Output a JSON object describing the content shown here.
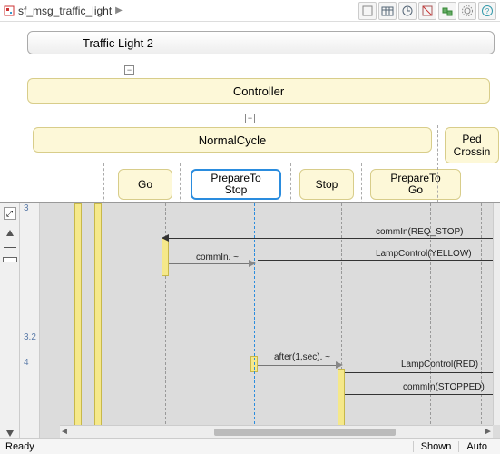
{
  "breadcrumb": {
    "file": "sf_msg_traffic_light"
  },
  "toolbar_icons": [
    "icon-a",
    "icon-b",
    "icon-c",
    "icon-d",
    "icon-e",
    "icon-f",
    "icon-g"
  ],
  "states": {
    "traffic_light_2": "Traffic Light 2",
    "controller": "Controller",
    "normal_cycle": "NormalCycle",
    "ped_crossing": "Ped Crossin",
    "go": "Go",
    "prepare_to_stop": "PrepareTo Stop",
    "stop": "Stop",
    "prepare_to_go": "PrepareTo Go"
  },
  "collapse_glyph": "⊟",
  "timeline": {
    "t1": "3",
    "t2": "3.2",
    "t3": "4"
  },
  "messages": {
    "req_stop": "commIn(REQ_STOP)",
    "commin": "commIn. ~",
    "lamp_yellow": "LampControl(YELLOW)",
    "after1": "after(1,sec). ~",
    "lamp_red": "LampControl(RED)",
    "stopped": "commIn(STOPPED)"
  },
  "status": {
    "ready": "Ready",
    "shown": "Shown",
    "auto": "Auto"
  }
}
